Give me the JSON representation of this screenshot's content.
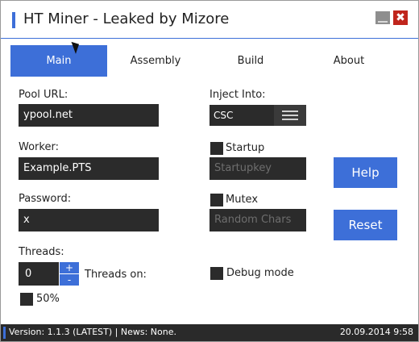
{
  "window": {
    "title": "HT Miner - Leaked by Mizore",
    "accent": "#3d6fd8",
    "close_glyph": "✖"
  },
  "tabs": [
    {
      "label": "Main",
      "active": true
    },
    {
      "label": "Assembly",
      "active": false
    },
    {
      "label": "Build",
      "active": false
    },
    {
      "label": "About",
      "active": false
    }
  ],
  "form": {
    "pool_url": {
      "label": "Pool URL:",
      "value": "ypool.net"
    },
    "worker": {
      "label": "Worker:",
      "value": "Example.PTS"
    },
    "password": {
      "label": "Password:",
      "value": "x"
    },
    "threads": {
      "label": "Threads:",
      "value": "0",
      "up": "+",
      "down": "-",
      "on_label": "Threads on:"
    },
    "fifty_percent": {
      "label": "50%",
      "checked": false
    },
    "inject_into": {
      "label": "Inject Into:",
      "value": "CSC"
    },
    "startup": {
      "label": "Startup",
      "checked": false,
      "key_placeholder": "Startupkey"
    },
    "mutex": {
      "label": "Mutex",
      "checked": false,
      "placeholder": "Random Chars"
    },
    "debug_mode": {
      "label": "Debug mode",
      "checked": false
    }
  },
  "buttons": {
    "help": "Help",
    "reset": "Reset"
  },
  "statusbar": {
    "left": "Version: 1.1.3 (LATEST) | News: None.",
    "right": "20.09.2014 9:58"
  }
}
